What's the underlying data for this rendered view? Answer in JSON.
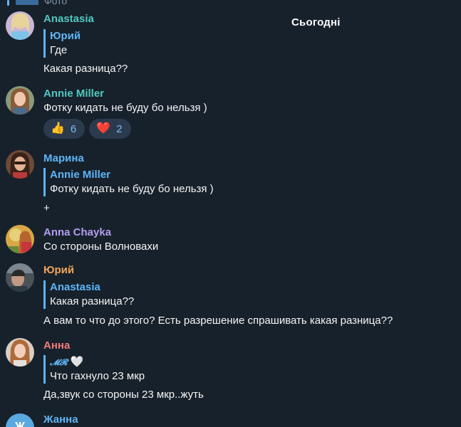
{
  "top_fragment": {
    "text": "Фото"
  },
  "date_separator": "Сьогодні",
  "messages": [
    {
      "sender": "Anastasia",
      "reply": {
        "name": "Юрий",
        "text": "Где"
      },
      "text": "Какая разница??"
    },
    {
      "sender": "Annie Miller",
      "text": "Фотку кидать не буду бо нельзя )",
      "reactions": [
        {
          "emoji": "👍",
          "count": "6"
        },
        {
          "emoji": "❤️",
          "count": "2"
        }
      ]
    },
    {
      "sender": "Марина",
      "reply": {
        "name": "Annie Miller",
        "text": "Фотку кидать не буду бо нельзя )"
      },
      "text": "+"
    },
    {
      "sender": "Anna Chayka",
      "text": "Со стороны Волновахи"
    },
    {
      "sender": "Юрий",
      "reply": {
        "name": "Anastasia",
        "text": "Какая разница??"
      },
      "text": "А вам то что до этого? Есть разрешение спрашивать какая разница??"
    },
    {
      "sender": "Анна",
      "reply": {
        "name": "𝓜𝓡",
        "name_emoji": "🤍",
        "text": "Что гахнуло 23 мкр"
      },
      "text": "Да,звук со стороны 23 мкр..жуть"
    },
    {
      "sender": "Жанна",
      "avatar_letter": "Ж"
    }
  ],
  "colors": {
    "background": "#17212b",
    "accent": "#5eb5f7",
    "reaction_bg": "#2b3b4d"
  }
}
